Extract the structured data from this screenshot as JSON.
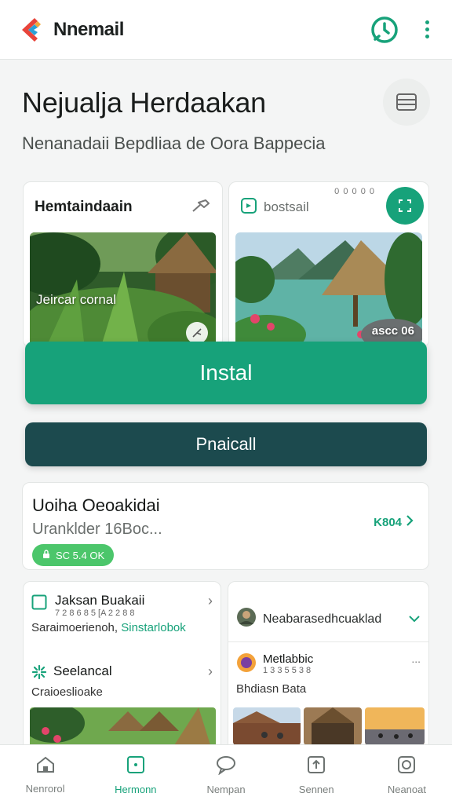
{
  "appbar": {
    "app_name": "Nnemail",
    "timer_icon": "timer-icon",
    "more_icon": "more-vertical-icon"
  },
  "header": {
    "title": "Nejualja Herdaakan",
    "subtitle": "Nenanadaii Bepdliaa de Oora Bappecia"
  },
  "cards": [
    {
      "title": "Hemtaindaain",
      "caption": "Jeircar cornal",
      "icon": "pin-icon"
    },
    {
      "title": "bostsail",
      "hint": "ascc 06",
      "dots": "0 0 0 0 0"
    }
  ],
  "buttons": {
    "primary": "Instal",
    "secondary": "Pnaicall"
  },
  "info_card": {
    "title": "Uoiha Oeoakidai",
    "subtitle": "Uranklder 16Boc...",
    "link": "K804",
    "status": "SC 5.4 OK"
  },
  "left_panel": {
    "items": [
      {
        "title": "Jaksan Buakaii",
        "meta": "7 2 8 6 8 5   [A 2 2 8 8",
        "desc_plain": "Saraimoerienoh,",
        "desc_accent": "Sinstarlobok"
      },
      {
        "title": "Seelancal",
        "desc": "Craioeslioake"
      }
    ]
  },
  "right_panel": {
    "header": "Neabarasedhcuaklad",
    "post": {
      "author": "Metlabbic",
      "meta": "1 3 3 5 5 3 8",
      "text": "Bhdiasn Bata",
      "more": "..."
    }
  },
  "bottom_nav": [
    {
      "label": "Nenrorol",
      "icon": "home-icon"
    },
    {
      "label": "Hermonn",
      "icon": "square-icon",
      "active": true
    },
    {
      "label": "Nempan",
      "icon": "chat-icon"
    },
    {
      "label": "Sennen",
      "icon": "plus-square-icon"
    },
    {
      "label": "Neanoat",
      "icon": "circle-square-icon"
    }
  ],
  "colors": {
    "accent": "#17a27a",
    "secondary": "#1c4a4e",
    "status_green": "#4cc66b"
  }
}
